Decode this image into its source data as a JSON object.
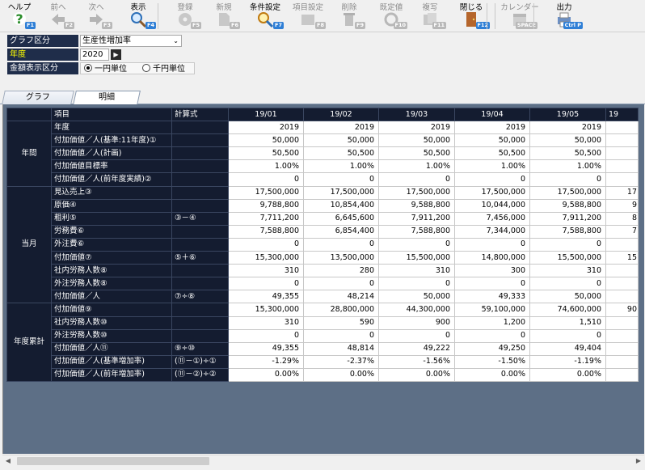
{
  "toolbar": {
    "items": [
      {
        "label": "ヘルプ",
        "key": "F1",
        "icon": "help-icon",
        "enabled": true
      },
      {
        "label": "前へ",
        "key": "F2",
        "icon": "arrow-left-icon",
        "enabled": false
      },
      {
        "label": "次へ",
        "key": "F3",
        "icon": "arrow-right-icon",
        "enabled": false
      },
      {
        "label": "表示",
        "key": "F4",
        "icon": "magnifier-icon",
        "enabled": true
      },
      {
        "label": "登録",
        "key": "F5",
        "icon": "save-disc-icon",
        "enabled": false
      },
      {
        "label": "新規",
        "key": "F6",
        "icon": "new-document-icon",
        "enabled": false
      },
      {
        "label": "条件設定",
        "key": "F7",
        "icon": "search-settings-icon",
        "enabled": true
      },
      {
        "label": "項目設定",
        "key": "F8",
        "icon": "item-settings-icon",
        "enabled": false
      },
      {
        "label": "削除",
        "key": "F9",
        "icon": "trash-icon",
        "enabled": false
      },
      {
        "label": "既定値",
        "key": "F10",
        "icon": "refresh-icon",
        "enabled": false
      },
      {
        "label": "複写",
        "key": "F11",
        "icon": "copy-icon",
        "enabled": false
      },
      {
        "label": "閉じる",
        "key": "F12",
        "icon": "door-icon",
        "enabled": true
      },
      {
        "label": "カレンダー",
        "key": "SPACE",
        "icon": "calendar-icon",
        "enabled": false
      },
      {
        "label": "出力",
        "key": "Ctrl P",
        "icon": "printer-icon",
        "enabled": true
      }
    ]
  },
  "filters": {
    "graph_label": "グラフ区分",
    "graph_value": "生産性増加率",
    "year_label": "年度",
    "year_value": "2020",
    "year_button": "▶",
    "amount_label": "金額表示区分",
    "amount_options": [
      "一円単位",
      "千円単位"
    ],
    "amount_selected": 0
  },
  "tabs": [
    "グラフ",
    "明細"
  ],
  "active_tab": 1,
  "grid": {
    "header": {
      "item": "項目",
      "formula": "計算式",
      "months": [
        "19/01",
        "19/02",
        "19/03",
        "19/04",
        "19/05",
        "19"
      ]
    },
    "groups": [
      {
        "name": "年間",
        "rows": [
          {
            "item": "年度",
            "formula": "",
            "values": [
              "2019",
              "2019",
              "2019",
              "2019",
              "2019",
              ""
            ]
          },
          {
            "item": "付加価値／人(基準:11年度)①",
            "formula": "",
            "values": [
              "50,000",
              "50,000",
              "50,000",
              "50,000",
              "50,000",
              ""
            ]
          },
          {
            "item": "付加価値／人(計画)",
            "formula": "",
            "values": [
              "50,500",
              "50,500",
              "50,500",
              "50,500",
              "50,500",
              ""
            ]
          },
          {
            "item": "付加価値目標率",
            "formula": "",
            "values": [
              "1.00%",
              "1.00%",
              "1.00%",
              "1.00%",
              "1.00%",
              ""
            ]
          },
          {
            "item": "付加価値／人(前年度実績)②",
            "formula": "",
            "values": [
              "0",
              "0",
              "0",
              "0",
              "0",
              ""
            ]
          }
        ]
      },
      {
        "name": "当月",
        "rows": [
          {
            "item": "見込売上③",
            "formula": "",
            "values": [
              "17,500,000",
              "17,500,000",
              "17,500,000",
              "17,500,000",
              "17,500,000",
              "17"
            ]
          },
          {
            "item": "原価④",
            "formula": "",
            "values": [
              "9,788,800",
              "10,854,400",
              "9,588,800",
              "10,044,000",
              "9,588,800",
              "9"
            ]
          },
          {
            "item": "粗利⑤",
            "formula": "③－④",
            "values": [
              "7,711,200",
              "6,645,600",
              "7,911,200",
              "7,456,000",
              "7,911,200",
              "8"
            ]
          },
          {
            "item": "労務費⑥",
            "formula": "",
            "values": [
              "7,588,800",
              "6,854,400",
              "7,588,800",
              "7,344,000",
              "7,588,800",
              "7"
            ]
          },
          {
            "item": "外注費⑥",
            "formula": "",
            "values": [
              "0",
              "0",
              "0",
              "0",
              "0",
              ""
            ]
          },
          {
            "item": "付加価値⑦",
            "formula": "⑤＋⑥",
            "values": [
              "15,300,000",
              "13,500,000",
              "15,500,000",
              "14,800,000",
              "15,500,000",
              "15"
            ]
          },
          {
            "item": "社内労務人数⑧",
            "formula": "",
            "values": [
              "310",
              "280",
              "310",
              "300",
              "310",
              ""
            ]
          },
          {
            "item": "外注労務人数⑧",
            "formula": "",
            "values": [
              "0",
              "0",
              "0",
              "0",
              "0",
              ""
            ]
          },
          {
            "item": "付加価値／人",
            "formula": "⑦÷⑧",
            "values": [
              "49,355",
              "48,214",
              "50,000",
              "49,333",
              "50,000",
              ""
            ]
          }
        ]
      },
      {
        "name": "年度累計",
        "rows": [
          {
            "item": "付加価値⑨",
            "formula": "",
            "values": [
              "15,300,000",
              "28,800,000",
              "44,300,000",
              "59,100,000",
              "74,600,000",
              "90"
            ]
          },
          {
            "item": "社内労務人数⑩",
            "formula": "",
            "values": [
              "310",
              "590",
              "900",
              "1,200",
              "1,510",
              ""
            ]
          },
          {
            "item": "外注労務人数⑩",
            "formula": "",
            "values": [
              "0",
              "0",
              "0",
              "0",
              "0",
              ""
            ]
          },
          {
            "item": "付加価値／人⑪",
            "formula": "⑨÷⑩",
            "values": [
              "49,355",
              "48,814",
              "49,222",
              "49,250",
              "49,404",
              ""
            ]
          },
          {
            "item": "付加価値／人(基準増加率)",
            "formula": "(⑪－①)÷①",
            "values": [
              "-1.29%",
              "-2.37%",
              "-1.56%",
              "-1.50%",
              "-1.19%",
              ""
            ]
          },
          {
            "item": "付加価値／人(前年増加率)",
            "formula": "(⑪－②)÷②",
            "values": [
              "0.00%",
              "0.00%",
              "0.00%",
              "0.00%",
              "0.00%",
              ""
            ]
          }
        ]
      }
    ]
  }
}
